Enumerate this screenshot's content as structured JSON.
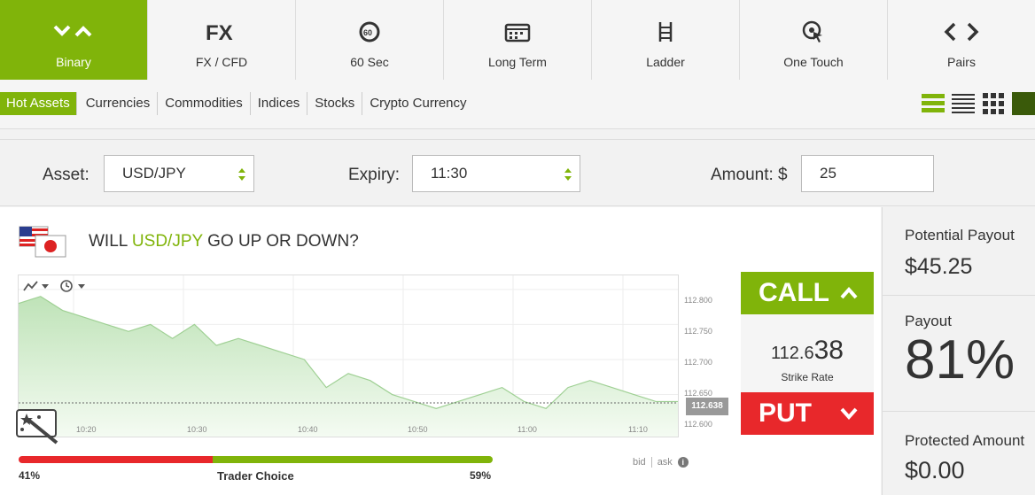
{
  "tabs": [
    {
      "label": "Binary",
      "icon": "binary-icon",
      "active": true
    },
    {
      "label": "FX / CFD",
      "icon": "fx-icon",
      "active": false
    },
    {
      "label": "60 Sec",
      "icon": "timer-60-icon",
      "active": false
    },
    {
      "label": "Long Term",
      "icon": "calendar-icon",
      "active": false
    },
    {
      "label": "Ladder",
      "icon": "ladder-icon",
      "active": false
    },
    {
      "label": "One Touch",
      "icon": "touch-icon",
      "active": false
    },
    {
      "label": "Pairs",
      "icon": "pairs-icon",
      "active": false
    }
  ],
  "categories": [
    "Hot Assets",
    "Currencies",
    "Commodities",
    "Indices",
    "Stocks",
    "Crypto Currency"
  ],
  "active_category": "Hot Assets",
  "form": {
    "asset_label": "Asset:",
    "asset_value": "USD/JPY",
    "expiry_label": "Expiry:",
    "expiry_value": "11:30",
    "amount_label": "Amount: $",
    "amount_value": "25"
  },
  "question": {
    "prefix": "WILL ",
    "asset": "USD/JPY",
    "suffix": " GO UP OR DOWN?"
  },
  "chart": {
    "y_ticks": [
      "112.800",
      "112.750",
      "112.700",
      "112.650",
      "112.600"
    ],
    "x_ticks": [
      "10:20",
      "10:30",
      "10:40",
      "10:50",
      "11:00",
      "11:10"
    ],
    "current_price": "112.638"
  },
  "chart_data": {
    "type": "area",
    "x": [
      "10:14",
      "10:16",
      "10:18",
      "10:20",
      "10:22",
      "10:24",
      "10:26",
      "10:28",
      "10:30",
      "10:32",
      "10:34",
      "10:36",
      "10:38",
      "10:39",
      "10:40",
      "10:42",
      "10:44",
      "10:46",
      "10:48",
      "10:50",
      "10:52",
      "10:54",
      "10:56",
      "10:58",
      "11:00",
      "11:02",
      "11:04",
      "11:06",
      "11:08",
      "11:10",
      "11:12"
    ],
    "values": [
      112.78,
      112.79,
      112.77,
      112.76,
      112.75,
      112.74,
      112.75,
      112.73,
      112.75,
      112.72,
      112.73,
      112.72,
      112.71,
      112.7,
      112.66,
      112.68,
      112.67,
      112.65,
      112.64,
      112.63,
      112.64,
      112.65,
      112.66,
      112.64,
      112.63,
      112.66,
      112.67,
      112.66,
      112.65,
      112.64,
      112.64
    ],
    "ylim": [
      112.59,
      112.82
    ],
    "current_value": 112.638,
    "grid": true
  },
  "trade": {
    "call_label": "CALL",
    "put_label": "PUT",
    "strike_small": "112.6",
    "strike_big": "38",
    "strike_label": "Strike Rate"
  },
  "sentiment": {
    "left_pct": "41%",
    "right_pct": "59%",
    "left_fraction": 0.41,
    "label": "Trader Choice",
    "bid": "bid",
    "ask": "ask"
  },
  "side": {
    "potential_label": "Potential Payout",
    "potential_value": "$45.25",
    "payout_label": "Payout",
    "payout_value": "81%",
    "protected_label": "Protected Amount",
    "protected_value": "$0.00"
  },
  "colors": {
    "accent": "#80b40a",
    "put": "#e8282b",
    "dark_green": "#3a5a0a"
  }
}
